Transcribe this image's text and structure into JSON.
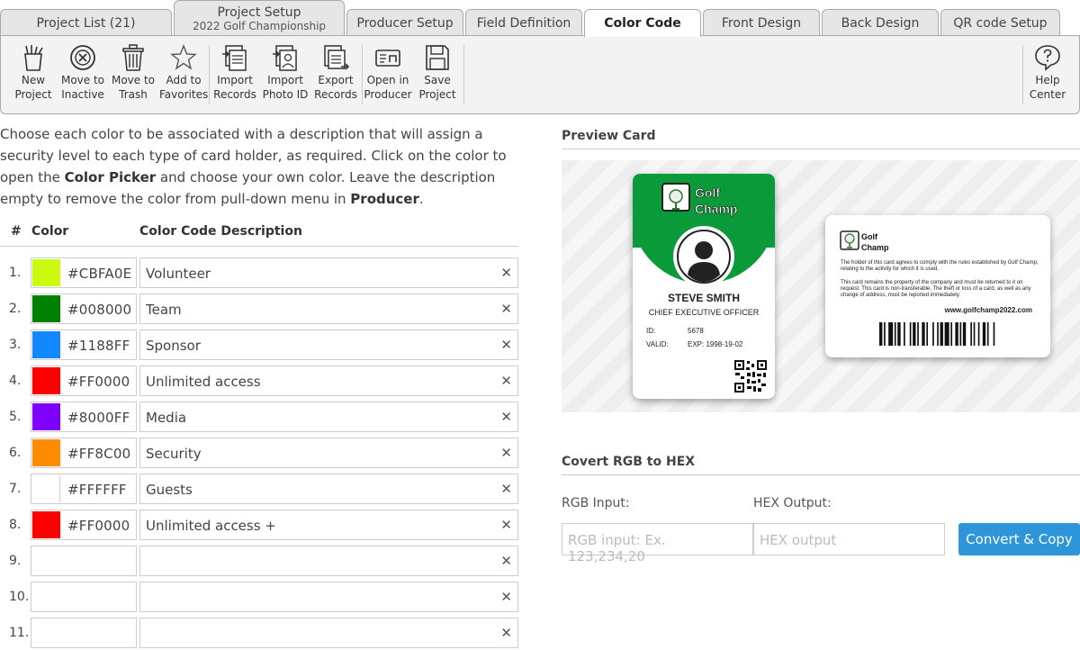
{
  "tabs": [
    {
      "label": "Project List (21)",
      "sub": ""
    },
    {
      "label": "Project Setup",
      "sub": "2022 Golf Championship"
    },
    {
      "label": "Producer Setup",
      "sub": ""
    },
    {
      "label": "Field Definition",
      "sub": ""
    },
    {
      "label": "Color Code",
      "sub": ""
    },
    {
      "label": "Front Design",
      "sub": ""
    },
    {
      "label": "Back Design",
      "sub": ""
    },
    {
      "label": "QR code Setup",
      "sub": ""
    }
  ],
  "toolbar": {
    "new_project": [
      "New",
      "Project"
    ],
    "move_inactive": [
      "Move to",
      "Inactive"
    ],
    "move_trash": [
      "Move to",
      "Trash"
    ],
    "add_favorites": [
      "Add to",
      "Favorites"
    ],
    "import_records": [
      "Import",
      "Records"
    ],
    "import_photo": [
      "Import",
      "Photo ID"
    ],
    "export_records": [
      "Export",
      "Records"
    ],
    "open_producer": [
      "Open in",
      "Producer"
    ],
    "save_project": [
      "Save",
      "Project"
    ],
    "help_center": [
      "Help",
      "Center"
    ]
  },
  "intro": {
    "p1": "Choose each color to be associated with a description that will assign a security level to each type of card holder, as required. Click on the color to open the ",
    "b1": "Color Picker",
    "p2": " and choose your own color. Leave the description empty to remove the color from pull-down menu in ",
    "b2": "Producer",
    "p3": "."
  },
  "table": {
    "headers": {
      "num": "#",
      "color": "Color",
      "desc": "Color Code Description"
    },
    "rows": [
      {
        "num": "1.",
        "color": "#CBFA0E",
        "hex": "#CBFA0E",
        "desc": "Volunteer"
      },
      {
        "num": "2.",
        "color": "#008000",
        "hex": "#008000",
        "desc": "Team"
      },
      {
        "num": "3.",
        "color": "#1188FF",
        "hex": "#1188FF",
        "desc": "Sponsor"
      },
      {
        "num": "4.",
        "color": "#FF0000",
        "hex": "#FF0000",
        "desc": "Unlimited access"
      },
      {
        "num": "5.",
        "color": "#8000FF",
        "hex": "#8000FF",
        "desc": "Media"
      },
      {
        "num": "6.",
        "color": "#FF8C00",
        "hex": "#FF8C00",
        "desc": "Security"
      },
      {
        "num": "7.",
        "color": "#FFFFFF",
        "hex": "#FFFFFF",
        "desc": "Guests"
      },
      {
        "num": "8.",
        "color": "#FF0000",
        "hex": "#FF0000",
        "desc": "Unlimited access +"
      },
      {
        "num": "9.",
        "color": "",
        "hex": "",
        "desc": ""
      },
      {
        "num": "10.",
        "color": "",
        "hex": "",
        "desc": ""
      },
      {
        "num": "11.",
        "color": "",
        "hex": "",
        "desc": ""
      }
    ],
    "clear_glyph": "✕"
  },
  "preview": {
    "heading": "Preview Card",
    "logo_line1": "Golf",
    "logo_line2": "Champ",
    "name": "STEVE SMITH",
    "job_title": "CHIEF EXECUTIVE OFFICER",
    "id_label": "ID:",
    "id_value": "5678",
    "valid_label": "VALID:",
    "valid_value": "EXP: 1998-19-02",
    "back_text1": "The holder of this card agrees to comply with the rules established by Golf Champ, relating to the activity for which it is used.",
    "back_text2": "This card remains the property of the company and must be returned to it on request. This card is non-transferable. The theft or loss of a card, as well as any change of address, must be reported immediately.",
    "website": "www.golfchamp2022.com"
  },
  "converter": {
    "heading": "Covert RGB to HEX",
    "rgb_label": "RGB Input:",
    "hex_label": "HEX Output:",
    "rgb_placeholder": "RGB input: Ex. 123,234,20",
    "hex_placeholder": "HEX output",
    "button": "Convert & Copy"
  },
  "colors": {
    "accent": "#2d95d8",
    "card_green": "#0a9a3a"
  }
}
